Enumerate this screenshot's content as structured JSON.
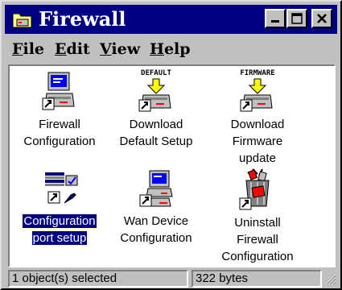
{
  "window": {
    "title": "Firewall"
  },
  "menu": {
    "items": [
      {
        "first": "F",
        "rest": "ile"
      },
      {
        "first": "E",
        "rest": "dit"
      },
      {
        "first": "V",
        "rest": "iew"
      },
      {
        "first": "H",
        "rest": "elp"
      }
    ]
  },
  "icons": [
    {
      "name": "firewall-configuration",
      "label_lines": [
        "Firewall",
        "Configuration"
      ],
      "badge": "",
      "icon": "computer-shortcut-icon",
      "selected": false
    },
    {
      "name": "download-default-setup",
      "label_lines": [
        "Download",
        "Default Setup"
      ],
      "badge": "DEFAULT",
      "icon": "download-device-icon",
      "selected": false
    },
    {
      "name": "download-firmware-update",
      "label_lines": [
        "Download",
        "Firmware",
        "update"
      ],
      "badge": "FIRMWARE",
      "icon": "download-device-icon",
      "selected": false
    },
    {
      "name": "configuration-port-setup",
      "label_lines": [
        "Configuration",
        "port setup"
      ],
      "badge": "",
      "icon": "port-setup-icon",
      "selected": true
    },
    {
      "name": "wan-device-configuration",
      "label_lines": [
        "Wan Device",
        "Configuration"
      ],
      "badge": "",
      "icon": "wan-device-icon",
      "selected": false
    },
    {
      "name": "uninstall-firewall-configuration",
      "label_lines": [
        "Uninstall",
        "Firewall",
        "Configuration"
      ],
      "badge": "",
      "icon": "uninstall-trash-icon",
      "selected": false
    }
  ],
  "status": {
    "left": "1 object(s) selected",
    "right": "322 bytes"
  }
}
